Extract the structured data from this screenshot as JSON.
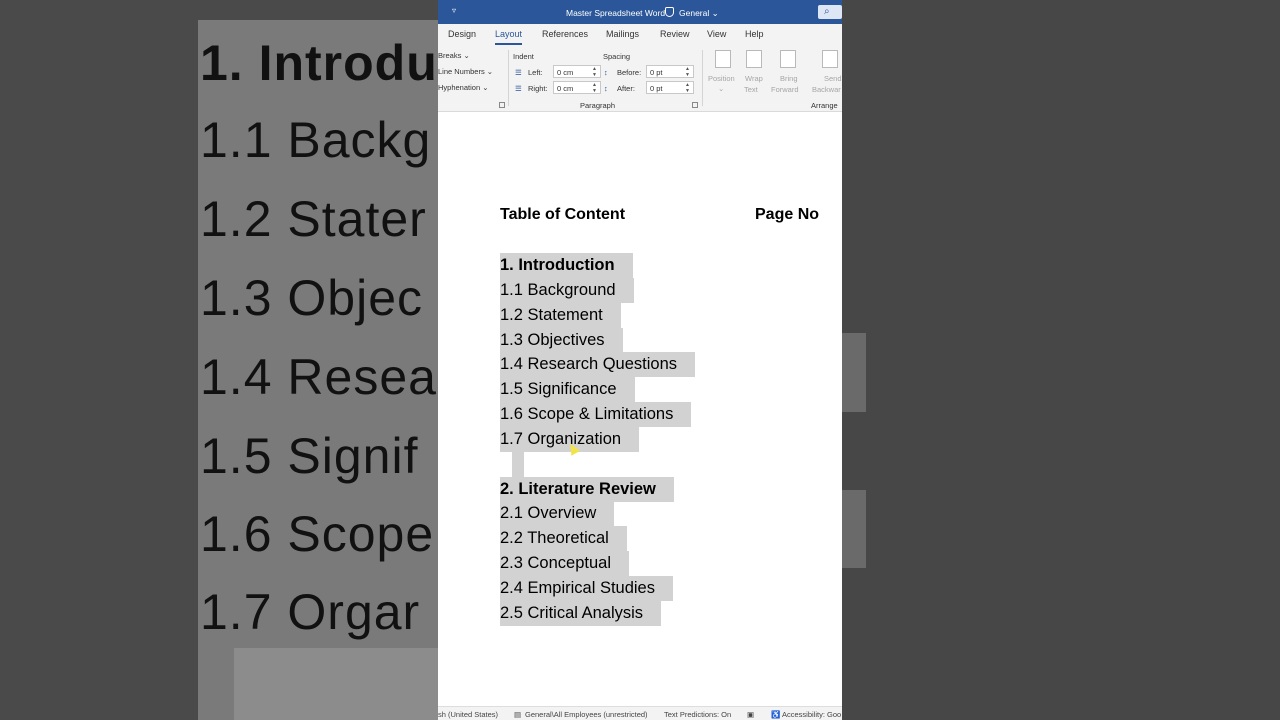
{
  "background": {
    "zoom_lines": [
      "1. Introdu",
      "1.1 Backg",
      "1.2 Stater",
      "1.3 Objec",
      "1.4 Resea",
      "1.5 Signif",
      "1.6 Scope",
      "1.7 Orgar"
    ]
  },
  "titlebar": {
    "doc_title": "Master Spreadsheet Word",
    "sensitivity": "General",
    "dropdown": "⌄"
  },
  "tabs": [
    "Design",
    "Layout",
    "References",
    "Mailings",
    "Review",
    "View",
    "Help"
  ],
  "ribbon": {
    "page_setup": {
      "breaks": "Breaks",
      "line_numbers": "Line Numbers",
      "hyphenation": "Hyphenation"
    },
    "paragraph": {
      "group_label": "Paragraph",
      "indent_label": "Indent",
      "spacing_label": "Spacing",
      "left_label": "Left:",
      "left_value": "0 cm",
      "right_label": "Right:",
      "right_value": "0 cm",
      "before_label": "Before:",
      "before_value": "0 pt",
      "after_label": "After:",
      "after_value": "0 pt"
    },
    "arrange": {
      "group_label": "Arrange",
      "position": "Position",
      "wrap_text_1": "Wrap",
      "wrap_text_2": "Text",
      "bring_forward_1": "Bring",
      "bring_forward_2": "Forward",
      "send_backward_1": "Send",
      "send_backward_2": "Backwar"
    }
  },
  "document": {
    "toc_title": "Table of Content",
    "page_no_label": "Page No",
    "items": [
      {
        "text": "1. Introduction",
        "bold": true
      },
      {
        "text": "1.1 Background",
        "bold": false
      },
      {
        "text": "1.2 Statement",
        "bold": false
      },
      {
        "text": "1.3 Objectives",
        "bold": false
      },
      {
        "text": "1.4 Research Questions",
        "bold": false
      },
      {
        "text": "1.5 Significance",
        "bold": false
      },
      {
        "text": "1.6 Scope & Limitations",
        "bold": false
      },
      {
        "text": "1.7 Organization",
        "bold": false
      },
      {
        "text": "",
        "bold": false
      },
      {
        "text": "2. Literature Review",
        "bold": true
      },
      {
        "text": "2.1 Overview",
        "bold": false
      },
      {
        "text": "2.2 Theoretical",
        "bold": false
      },
      {
        "text": "2.3 Conceptual",
        "bold": false
      },
      {
        "text": "2.4 Empirical Studies",
        "bold": false
      },
      {
        "text": "2.5 Critical Analysis",
        "bold": false
      }
    ]
  },
  "statusbar": {
    "language": "sh (United States)",
    "sensitivity": "General\\All Employees (unrestricted)",
    "text_predictions": "Text Predictions: On",
    "accessibility": "Accessibility: Goo"
  },
  "colors": {
    "accent": "#2b579a",
    "selection": "#d2d2d2",
    "ribbon_bg": "#f3f3f3"
  }
}
